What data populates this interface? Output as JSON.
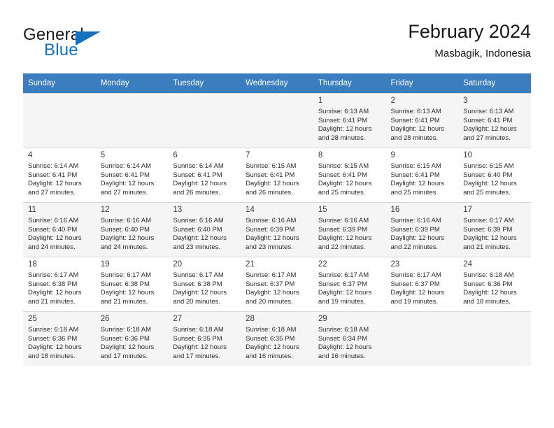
{
  "brand": {
    "name_part1": "General",
    "name_part2": "Blue",
    "logo_icon": "triangle-flag-icon"
  },
  "header": {
    "title": "February 2024",
    "subtitle": "Masbagik, Indonesia"
  },
  "calendar": {
    "weekday_headers": [
      "Sunday",
      "Monday",
      "Tuesday",
      "Wednesday",
      "Thursday",
      "Friday",
      "Saturday"
    ],
    "accent_color": "#3a7ebf",
    "shaded_row_color": "#f5f5f5",
    "weeks": [
      [
        {
          "day": "",
          "sunrise": "",
          "sunset": "",
          "daylight1": "",
          "daylight2": ""
        },
        {
          "day": "",
          "sunrise": "",
          "sunset": "",
          "daylight1": "",
          "daylight2": ""
        },
        {
          "day": "",
          "sunrise": "",
          "sunset": "",
          "daylight1": "",
          "daylight2": ""
        },
        {
          "day": "",
          "sunrise": "",
          "sunset": "",
          "daylight1": "",
          "daylight2": ""
        },
        {
          "day": "1",
          "sunrise": "Sunrise: 6:13 AM",
          "sunset": "Sunset: 6:41 PM",
          "daylight1": "Daylight: 12 hours",
          "daylight2": "and 28 minutes."
        },
        {
          "day": "2",
          "sunrise": "Sunrise: 6:13 AM",
          "sunset": "Sunset: 6:41 PM",
          "daylight1": "Daylight: 12 hours",
          "daylight2": "and 28 minutes."
        },
        {
          "day": "3",
          "sunrise": "Sunrise: 6:13 AM",
          "sunset": "Sunset: 6:41 PM",
          "daylight1": "Daylight: 12 hours",
          "daylight2": "and 27 minutes."
        }
      ],
      [
        {
          "day": "4",
          "sunrise": "Sunrise: 6:14 AM",
          "sunset": "Sunset: 6:41 PM",
          "daylight1": "Daylight: 12 hours",
          "daylight2": "and 27 minutes."
        },
        {
          "day": "5",
          "sunrise": "Sunrise: 6:14 AM",
          "sunset": "Sunset: 6:41 PM",
          "daylight1": "Daylight: 12 hours",
          "daylight2": "and 27 minutes."
        },
        {
          "day": "6",
          "sunrise": "Sunrise: 6:14 AM",
          "sunset": "Sunset: 6:41 PM",
          "daylight1": "Daylight: 12 hours",
          "daylight2": "and 26 minutes."
        },
        {
          "day": "7",
          "sunrise": "Sunrise: 6:15 AM",
          "sunset": "Sunset: 6:41 PM",
          "daylight1": "Daylight: 12 hours",
          "daylight2": "and 26 minutes."
        },
        {
          "day": "8",
          "sunrise": "Sunrise: 6:15 AM",
          "sunset": "Sunset: 6:41 PM",
          "daylight1": "Daylight: 12 hours",
          "daylight2": "and 25 minutes."
        },
        {
          "day": "9",
          "sunrise": "Sunrise: 6:15 AM",
          "sunset": "Sunset: 6:41 PM",
          "daylight1": "Daylight: 12 hours",
          "daylight2": "and 25 minutes."
        },
        {
          "day": "10",
          "sunrise": "Sunrise: 6:15 AM",
          "sunset": "Sunset: 6:40 PM",
          "daylight1": "Daylight: 12 hours",
          "daylight2": "and 25 minutes."
        }
      ],
      [
        {
          "day": "11",
          "sunrise": "Sunrise: 6:16 AM",
          "sunset": "Sunset: 6:40 PM",
          "daylight1": "Daylight: 12 hours",
          "daylight2": "and 24 minutes."
        },
        {
          "day": "12",
          "sunrise": "Sunrise: 6:16 AM",
          "sunset": "Sunset: 6:40 PM",
          "daylight1": "Daylight: 12 hours",
          "daylight2": "and 24 minutes."
        },
        {
          "day": "13",
          "sunrise": "Sunrise: 6:16 AM",
          "sunset": "Sunset: 6:40 PM",
          "daylight1": "Daylight: 12 hours",
          "daylight2": "and 23 minutes."
        },
        {
          "day": "14",
          "sunrise": "Sunrise: 6:16 AM",
          "sunset": "Sunset: 6:39 PM",
          "daylight1": "Daylight: 12 hours",
          "daylight2": "and 23 minutes."
        },
        {
          "day": "15",
          "sunrise": "Sunrise: 6:16 AM",
          "sunset": "Sunset: 6:39 PM",
          "daylight1": "Daylight: 12 hours",
          "daylight2": "and 22 minutes."
        },
        {
          "day": "16",
          "sunrise": "Sunrise: 6:16 AM",
          "sunset": "Sunset: 6:39 PM",
          "daylight1": "Daylight: 12 hours",
          "daylight2": "and 22 minutes."
        },
        {
          "day": "17",
          "sunrise": "Sunrise: 6:17 AM",
          "sunset": "Sunset: 6:39 PM",
          "daylight1": "Daylight: 12 hours",
          "daylight2": "and 21 minutes."
        }
      ],
      [
        {
          "day": "18",
          "sunrise": "Sunrise: 6:17 AM",
          "sunset": "Sunset: 6:38 PM",
          "daylight1": "Daylight: 12 hours",
          "daylight2": "and 21 minutes."
        },
        {
          "day": "19",
          "sunrise": "Sunrise: 6:17 AM",
          "sunset": "Sunset: 6:38 PM",
          "daylight1": "Daylight: 12 hours",
          "daylight2": "and 21 minutes."
        },
        {
          "day": "20",
          "sunrise": "Sunrise: 6:17 AM",
          "sunset": "Sunset: 6:38 PM",
          "daylight1": "Daylight: 12 hours",
          "daylight2": "and 20 minutes."
        },
        {
          "day": "21",
          "sunrise": "Sunrise: 6:17 AM",
          "sunset": "Sunset: 6:37 PM",
          "daylight1": "Daylight: 12 hours",
          "daylight2": "and 20 minutes."
        },
        {
          "day": "22",
          "sunrise": "Sunrise: 6:17 AM",
          "sunset": "Sunset: 6:37 PM",
          "daylight1": "Daylight: 12 hours",
          "daylight2": "and 19 minutes."
        },
        {
          "day": "23",
          "sunrise": "Sunrise: 6:17 AM",
          "sunset": "Sunset: 6:37 PM",
          "daylight1": "Daylight: 12 hours",
          "daylight2": "and 19 minutes."
        },
        {
          "day": "24",
          "sunrise": "Sunrise: 6:18 AM",
          "sunset": "Sunset: 6:36 PM",
          "daylight1": "Daylight: 12 hours",
          "daylight2": "and 18 minutes."
        }
      ],
      [
        {
          "day": "25",
          "sunrise": "Sunrise: 6:18 AM",
          "sunset": "Sunset: 6:36 PM",
          "daylight1": "Daylight: 12 hours",
          "daylight2": "and 18 minutes."
        },
        {
          "day": "26",
          "sunrise": "Sunrise: 6:18 AM",
          "sunset": "Sunset: 6:36 PM",
          "daylight1": "Daylight: 12 hours",
          "daylight2": "and 17 minutes."
        },
        {
          "day": "27",
          "sunrise": "Sunrise: 6:18 AM",
          "sunset": "Sunset: 6:35 PM",
          "daylight1": "Daylight: 12 hours",
          "daylight2": "and 17 minutes."
        },
        {
          "day": "28",
          "sunrise": "Sunrise: 6:18 AM",
          "sunset": "Sunset: 6:35 PM",
          "daylight1": "Daylight: 12 hours",
          "daylight2": "and 16 minutes."
        },
        {
          "day": "29",
          "sunrise": "Sunrise: 6:18 AM",
          "sunset": "Sunset: 6:34 PM",
          "daylight1": "Daylight: 12 hours",
          "daylight2": "and 16 minutes."
        },
        {
          "day": "",
          "sunrise": "",
          "sunset": "",
          "daylight1": "",
          "daylight2": ""
        },
        {
          "day": "",
          "sunrise": "",
          "sunset": "",
          "daylight1": "",
          "daylight2": ""
        }
      ]
    ]
  }
}
